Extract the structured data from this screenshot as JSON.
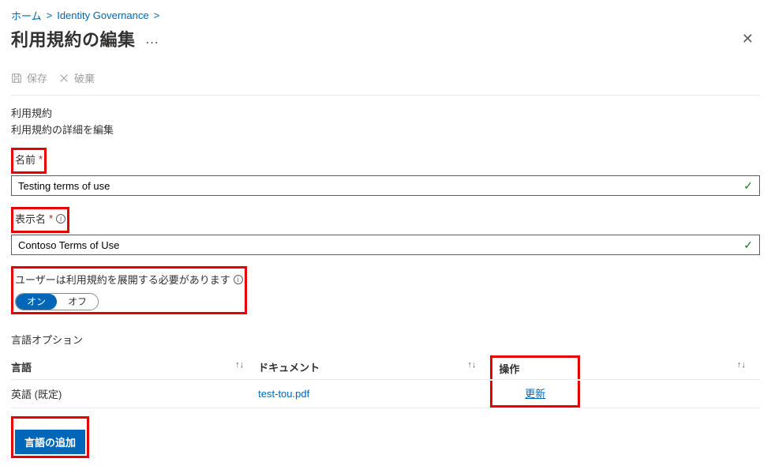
{
  "breadcrumb": {
    "home": "ホーム",
    "idgov": "Identity Governance"
  },
  "page": {
    "title": "利用規約の編集",
    "more": "…"
  },
  "toolbar": {
    "save": "保存",
    "discard": "破棄"
  },
  "section": {
    "heading": "利用規約",
    "sub": "利用規約の詳細を編集"
  },
  "fields": {
    "name_label": "名前",
    "name_value": "Testing terms of use",
    "display_label": "表示名",
    "display_value": "Contoso Terms of Use",
    "expand_label": "ユーザーは利用規約を展開する必要があります",
    "toggle_on": "オン",
    "toggle_off": "オフ"
  },
  "required_mark": "*",
  "languages": {
    "heading": "言語オプション",
    "columns": {
      "lang": "言語",
      "doc": "ドキュメント",
      "action": "操作"
    },
    "rows": [
      {
        "lang": "英語 (既定)",
        "doc": "test-tou.pdf",
        "action": "更新"
      }
    ],
    "add_btn": "言語の追加"
  }
}
